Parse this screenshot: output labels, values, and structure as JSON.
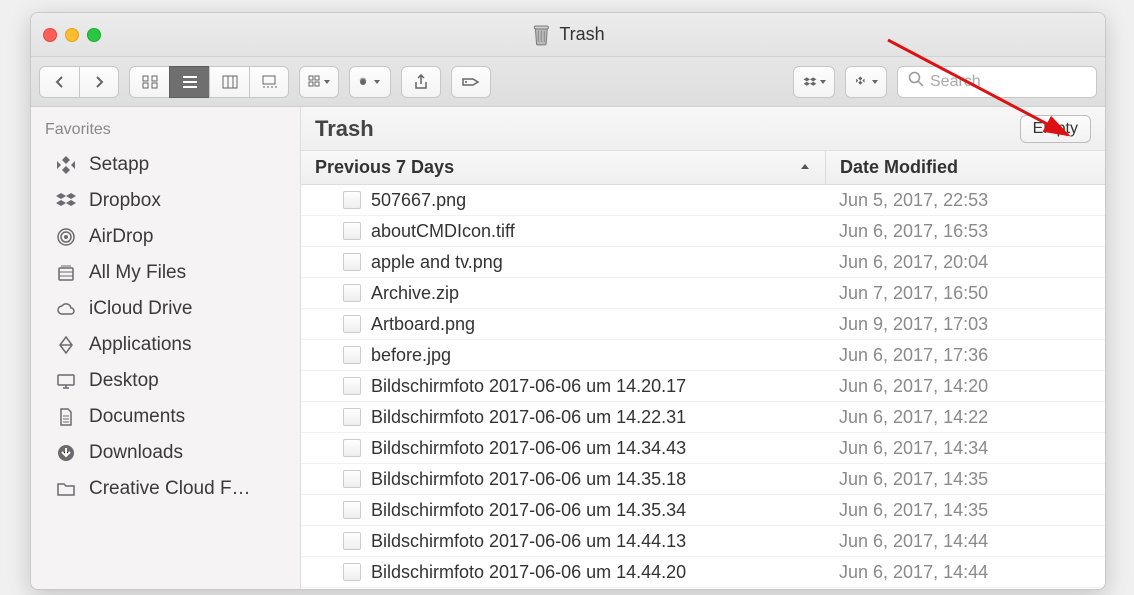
{
  "window": {
    "title": "Trash"
  },
  "toolbar": {
    "search_placeholder": "Search"
  },
  "sidebar": {
    "header": "Favorites",
    "items": [
      {
        "label": "Setapp"
      },
      {
        "label": "Dropbox"
      },
      {
        "label": "AirDrop"
      },
      {
        "label": "All My Files"
      },
      {
        "label": "iCloud Drive"
      },
      {
        "label": "Applications"
      },
      {
        "label": "Desktop"
      },
      {
        "label": "Documents"
      },
      {
        "label": "Downloads"
      },
      {
        "label": "Creative Cloud F…"
      }
    ]
  },
  "main": {
    "title": "Trash",
    "empty_label": "Empty",
    "columns": {
      "group_label": "Previous 7 Days",
      "date_label": "Date Modified"
    },
    "files": [
      {
        "name": "507667.png",
        "date": "Jun 5, 2017, 22:53"
      },
      {
        "name": "aboutCMDIcon.tiff",
        "date": "Jun 6, 2017, 16:53"
      },
      {
        "name": "apple and tv.png",
        "date": "Jun 6, 2017, 20:04"
      },
      {
        "name": "Archive.zip",
        "date": "Jun 7, 2017, 16:50"
      },
      {
        "name": "Artboard.png",
        "date": "Jun 9, 2017, 17:03"
      },
      {
        "name": "before.jpg",
        "date": "Jun 6, 2017, 17:36"
      },
      {
        "name": "Bildschirmfoto 2017-06-06 um 14.20.17",
        "date": "Jun 6, 2017, 14:20"
      },
      {
        "name": "Bildschirmfoto 2017-06-06 um 14.22.31",
        "date": "Jun 6, 2017, 14:22"
      },
      {
        "name": "Bildschirmfoto 2017-06-06 um 14.34.43",
        "date": "Jun 6, 2017, 14:34"
      },
      {
        "name": "Bildschirmfoto 2017-06-06 um 14.35.18",
        "date": "Jun 6, 2017, 14:35"
      },
      {
        "name": "Bildschirmfoto 2017-06-06 um 14.35.34",
        "date": "Jun 6, 2017, 14:35"
      },
      {
        "name": "Bildschirmfoto 2017-06-06 um 14.44.13",
        "date": "Jun 6, 2017, 14:44"
      },
      {
        "name": "Bildschirmfoto 2017-06-06 um 14.44.20",
        "date": "Jun 6, 2017, 14:44"
      }
    ]
  }
}
